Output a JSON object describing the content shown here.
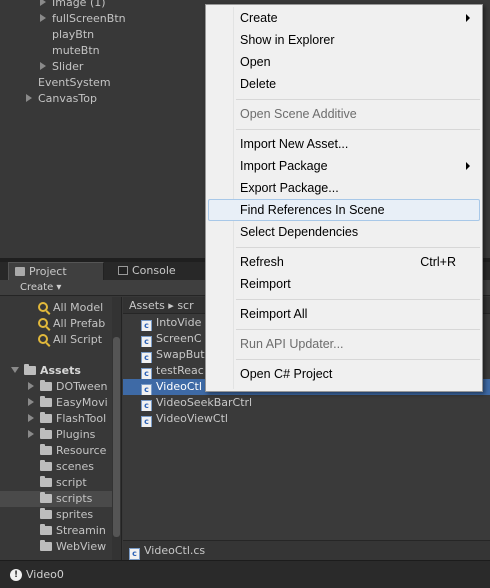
{
  "hierarchy": {
    "items": [
      {
        "label": "Image (1)",
        "expandable": true
      },
      {
        "label": "fullScreenBtn",
        "expandable": true
      },
      {
        "label": "playBtn",
        "expandable": false
      },
      {
        "label": "muteBtn",
        "expandable": false
      },
      {
        "label": "Slider",
        "expandable": true
      },
      {
        "label": "EventSystem",
        "expandable": false
      },
      {
        "label": "CanvasTop",
        "expandable": true
      }
    ]
  },
  "tabs": [
    {
      "label": "Project",
      "icon": "folder-icon",
      "active": true
    },
    {
      "label": "Console",
      "icon": "console-icon",
      "active": false
    }
  ],
  "toolbar": {
    "create_label": "Create ▾"
  },
  "project_left": {
    "favorites": [
      "All Model",
      "All Prefab",
      "All Script"
    ],
    "root": "Assets",
    "folders": [
      "DOTween",
      "EasyMovi",
      "FlashTool",
      "Plugins",
      "Resource",
      "scenes",
      "script",
      "scripts",
      "sprites",
      "Streamin",
      "WebView"
    ],
    "selected_folder": "scripts"
  },
  "project_right": {
    "breadcrumb": "Assets ▸ scr",
    "files": [
      "IntoVide",
      "ScreenC",
      "SwapBut",
      "testReac",
      "VideoCtl",
      "VideoSeekBarCtrl",
      "VideoViewCtl"
    ],
    "selected_file": "VideoCtl",
    "footer_file": "VideoCtl.cs"
  },
  "status": {
    "text": "Video0"
  },
  "context_menu": {
    "items": [
      {
        "label": "Create",
        "submenu": true
      },
      {
        "label": "Show in Explorer"
      },
      {
        "label": "Open"
      },
      {
        "label": "Delete"
      },
      {
        "label": "Open Scene Additive",
        "disabled": true
      },
      {
        "label": "Import New Asset..."
      },
      {
        "label": "Import Package",
        "submenu": true
      },
      {
        "label": "Export Package..."
      },
      {
        "label": "Find References In Scene",
        "hover": true
      },
      {
        "label": "Select Dependencies"
      },
      {
        "label": "Refresh",
        "shortcut": "Ctrl+R"
      },
      {
        "label": "Reimport"
      },
      {
        "label": "Reimport All"
      },
      {
        "label": "Run API Updater...",
        "disabled": true
      },
      {
        "label": "Open C# Project"
      }
    ]
  }
}
